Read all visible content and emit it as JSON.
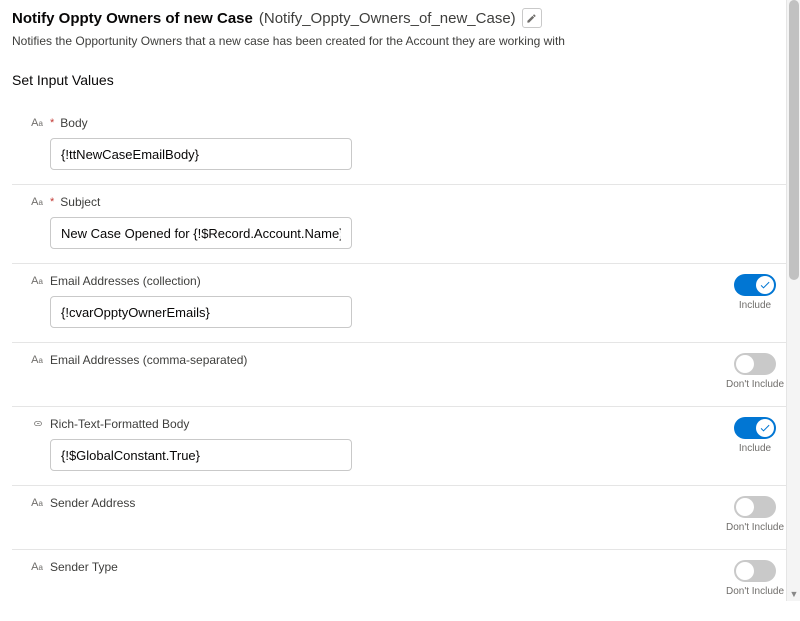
{
  "header": {
    "title": "Notify Oppty Owners of new Case",
    "apiName": "(Notify_Oppty_Owners_of_new_Case)"
  },
  "description": "Notifies the Opportunity Owners that a new case has been created for the Account they are working with",
  "sectionHeading": "Set Input Values",
  "fields": {
    "body": {
      "label": "Body",
      "value": "{!ttNewCaseEmailBody}"
    },
    "subject": {
      "label": "Subject",
      "value": "New Case Opened for {!$Record.Account.Name}"
    },
    "emailCollection": {
      "label": "Email Addresses (collection)",
      "value": "{!cvarOpptyOwnerEmails}",
      "toggleLabel": "Include"
    },
    "emailComma": {
      "label": "Email Addresses (comma-separated)",
      "toggleLabel": "Don't Include"
    },
    "richText": {
      "label": "Rich-Text-Formatted Body",
      "value": "{!$GlobalConstant.True}",
      "toggleLabel": "Include"
    },
    "senderAddress": {
      "label": "Sender Address",
      "toggleLabel": "Don't Include"
    },
    "senderType": {
      "label": "Sender Type",
      "toggleLabel": "Don't Include"
    }
  }
}
